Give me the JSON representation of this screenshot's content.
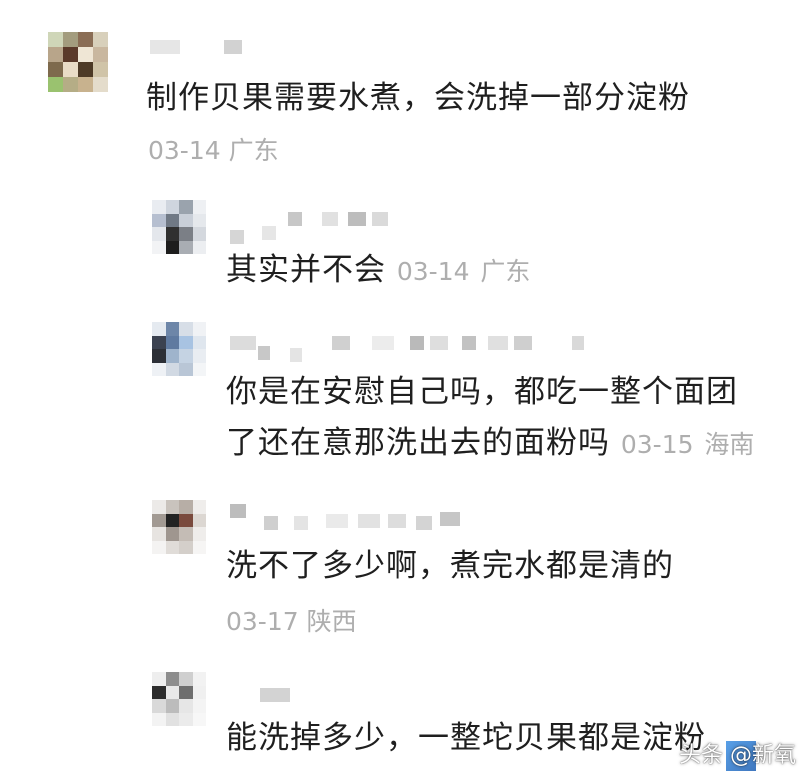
{
  "comments": [
    {
      "text": "制作贝果需要水煮，会洗掉一部分淀粉",
      "date": "03-14",
      "location": "广东"
    },
    {
      "text": "其实并不会",
      "date": "03-14",
      "location": "广东"
    },
    {
      "line1": "你是在安慰自己吗，都吃一整个面团",
      "line2": "了还在意那洗出去的面粉吗",
      "date": "03-15",
      "location": "海南"
    },
    {
      "text": "洗不了多少啊，煮完水都是清的",
      "date": "03-17",
      "location": "陕西"
    },
    {
      "text": "能洗掉多少，一整坨贝果都是淀粉"
    }
  ],
  "watermark": {
    "text": "头条 @新氧"
  }
}
